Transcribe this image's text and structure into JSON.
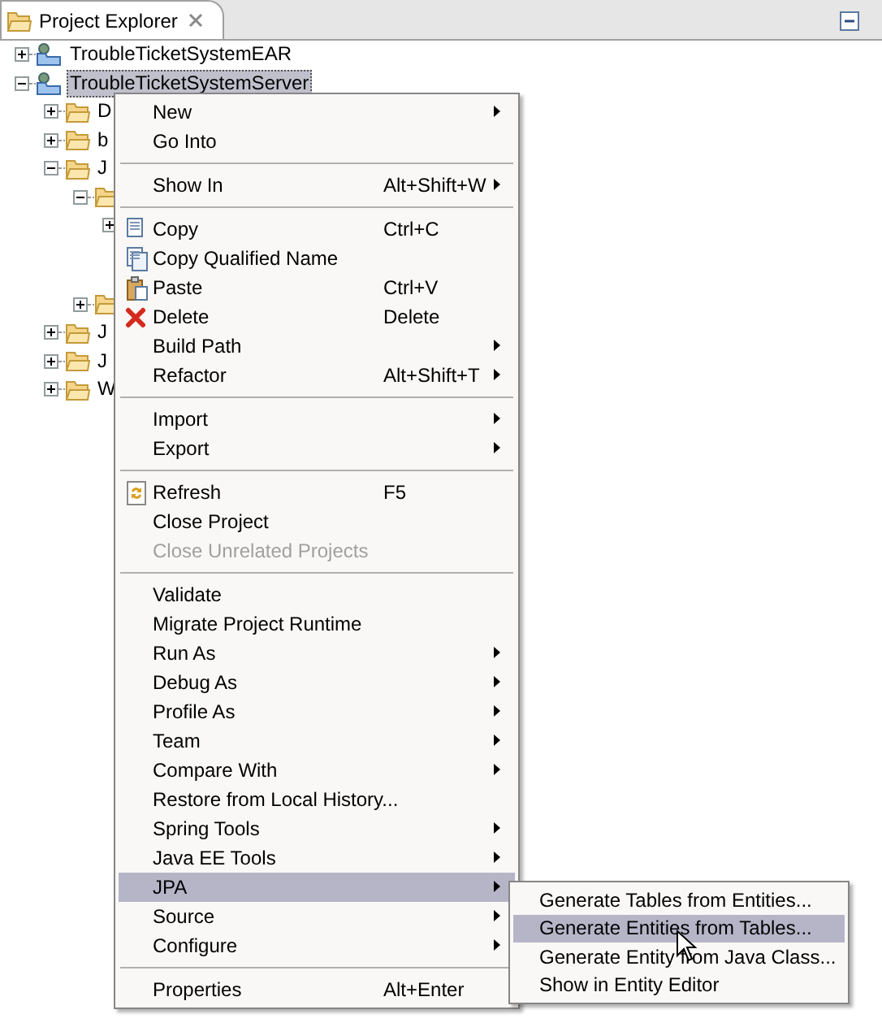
{
  "view": {
    "title": "Project Explorer"
  },
  "tree": [
    {
      "label": "TroubleTicketSystemEAR",
      "expanded": false,
      "selected": false
    },
    {
      "label": "TroubleTicketSystemServer",
      "expanded": true,
      "selected": true,
      "children": [
        {
          "label": "D",
          "expanded": false,
          "selected": false
        },
        {
          "label": "b",
          "expanded": false,
          "selected": false
        },
        {
          "label": "J",
          "expanded": true,
          "selected": false,
          "children": [
            {
              "expanded": true,
              "children": [
                {
                  "expanded": false
                }
              ]
            },
            {
              "expanded": false
            }
          ]
        },
        {
          "label": "J",
          "expanded": false,
          "selected": false
        },
        {
          "label": "J",
          "expanded": false,
          "selected": false
        },
        {
          "label": "W",
          "expanded": false,
          "selected": false
        }
      ]
    }
  ],
  "context_menu": [
    {
      "kind": "item",
      "label": "New",
      "submenu": true,
      "selected": false,
      "disabled": false
    },
    {
      "kind": "item",
      "label": "Go Into",
      "submenu": false,
      "selected": false,
      "disabled": false
    },
    {
      "kind": "separator"
    },
    {
      "kind": "item",
      "label": "Show In",
      "shortcut": "Alt+Shift+W",
      "submenu": true,
      "selected": false,
      "disabled": false
    },
    {
      "kind": "separator"
    },
    {
      "kind": "item",
      "label": "Copy",
      "shortcut": "Ctrl+C",
      "submenu": false,
      "selected": false,
      "disabled": false
    },
    {
      "kind": "item",
      "label": "Copy Qualified Name",
      "submenu": false,
      "selected": false,
      "disabled": false
    },
    {
      "kind": "item",
      "label": "Paste",
      "shortcut": "Ctrl+V",
      "submenu": false,
      "selected": false,
      "disabled": false
    },
    {
      "kind": "item",
      "label": "Delete",
      "shortcut": "Delete",
      "submenu": false,
      "selected": false,
      "disabled": false
    },
    {
      "kind": "item",
      "label": "Build Path",
      "submenu": true,
      "selected": false,
      "disabled": false
    },
    {
      "kind": "item",
      "label": "Refactor",
      "shortcut": "Alt+Shift+T",
      "submenu": true,
      "selected": false,
      "disabled": false
    },
    {
      "kind": "separator"
    },
    {
      "kind": "item",
      "label": "Import",
      "submenu": true,
      "selected": false,
      "disabled": false
    },
    {
      "kind": "item",
      "label": "Export",
      "submenu": true,
      "selected": false,
      "disabled": false
    },
    {
      "kind": "separator"
    },
    {
      "kind": "item",
      "label": "Refresh",
      "shortcut": "F5",
      "submenu": false,
      "selected": false,
      "disabled": false
    },
    {
      "kind": "item",
      "label": "Close Project",
      "submenu": false,
      "selected": false,
      "disabled": false
    },
    {
      "kind": "item",
      "label": "Close Unrelated Projects",
      "submenu": false,
      "selected": false,
      "disabled": true
    },
    {
      "kind": "separator"
    },
    {
      "kind": "item",
      "label": "Validate",
      "submenu": false,
      "selected": false,
      "disabled": false
    },
    {
      "kind": "item",
      "label": "Migrate Project Runtime",
      "submenu": false,
      "selected": false,
      "disabled": false
    },
    {
      "kind": "item",
      "label": "Run As",
      "submenu": true,
      "selected": false,
      "disabled": false
    },
    {
      "kind": "item",
      "label": "Debug As",
      "submenu": true,
      "selected": false,
      "disabled": false
    },
    {
      "kind": "item",
      "label": "Profile As",
      "submenu": true,
      "selected": false,
      "disabled": false
    },
    {
      "kind": "item",
      "label": "Team",
      "submenu": true,
      "selected": false,
      "disabled": false
    },
    {
      "kind": "item",
      "label": "Compare With",
      "submenu": true,
      "selected": false,
      "disabled": false
    },
    {
      "kind": "item",
      "label": "Restore from Local History...",
      "submenu": false,
      "selected": false,
      "disabled": false
    },
    {
      "kind": "item",
      "label": "Spring Tools",
      "submenu": true,
      "selected": false,
      "disabled": false
    },
    {
      "kind": "item",
      "label": "Java EE Tools",
      "submenu": true,
      "selected": false,
      "disabled": false
    },
    {
      "kind": "item",
      "label": "JPA",
      "submenu": true,
      "selected": true,
      "disabled": false
    },
    {
      "kind": "item",
      "label": "Source",
      "submenu": true,
      "selected": false,
      "disabled": false
    },
    {
      "kind": "item",
      "label": "Configure",
      "submenu": true,
      "selected": false,
      "disabled": false
    },
    {
      "kind": "separator"
    },
    {
      "kind": "item",
      "label": "Properties",
      "shortcut": "Alt+Enter",
      "submenu": false,
      "selected": false,
      "disabled": false
    }
  ],
  "jpa_submenu": [
    {
      "label": "Generate Tables from Entities...",
      "selected": false
    },
    {
      "label": "Generate Entities from Tables...",
      "selected": true
    },
    {
      "label": "Generate Entity from Java Class...",
      "selected": false
    },
    {
      "label": "Show in Entity Editor",
      "selected": false
    }
  ]
}
